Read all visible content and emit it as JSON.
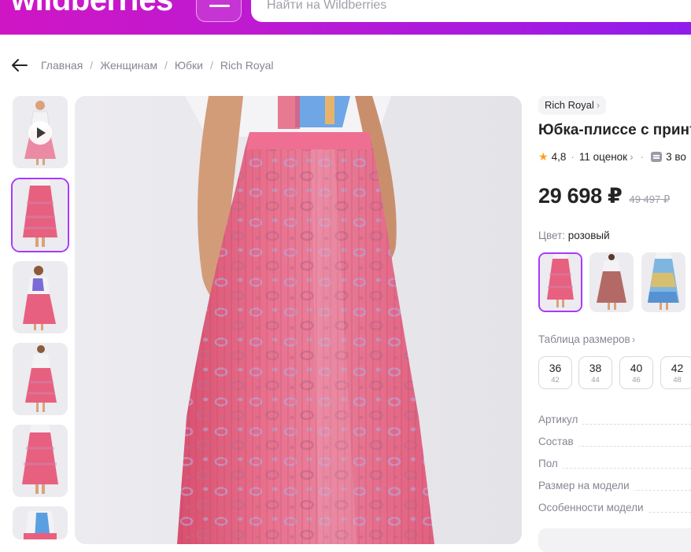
{
  "header": {
    "logo": "wildberries",
    "search_placeholder": "Найти на Wildberries"
  },
  "breadcrumbs": [
    "Главная",
    "Женщинам",
    "Юбки",
    "Rich Royal"
  ],
  "product": {
    "brand": "Rich Royal",
    "title": "Юбка-плиссе с принт",
    "rating": "4,8",
    "reviews": "11 оценок",
    "questions": "3 во",
    "price": "29 698 ₽",
    "old_price": "49 497 ₽",
    "color_label": "Цвет:",
    "color_value": "розовый",
    "size_table_label": "Таблица размеров",
    "sizes": [
      {
        "ru": "36",
        "eu": "42"
      },
      {
        "ru": "38",
        "eu": "44"
      },
      {
        "ru": "40",
        "eu": "46"
      },
      {
        "ru": "42",
        "eu": "48"
      }
    ],
    "specs": [
      "Артикул",
      "Состав",
      "Пол",
      "Размер на модели",
      "Особенности модели"
    ]
  },
  "colors": {
    "accent": "#a73afd",
    "header_start": "#cf16c4",
    "header_end": "#8f1cec",
    "skirt_pink": "#e8607f"
  }
}
